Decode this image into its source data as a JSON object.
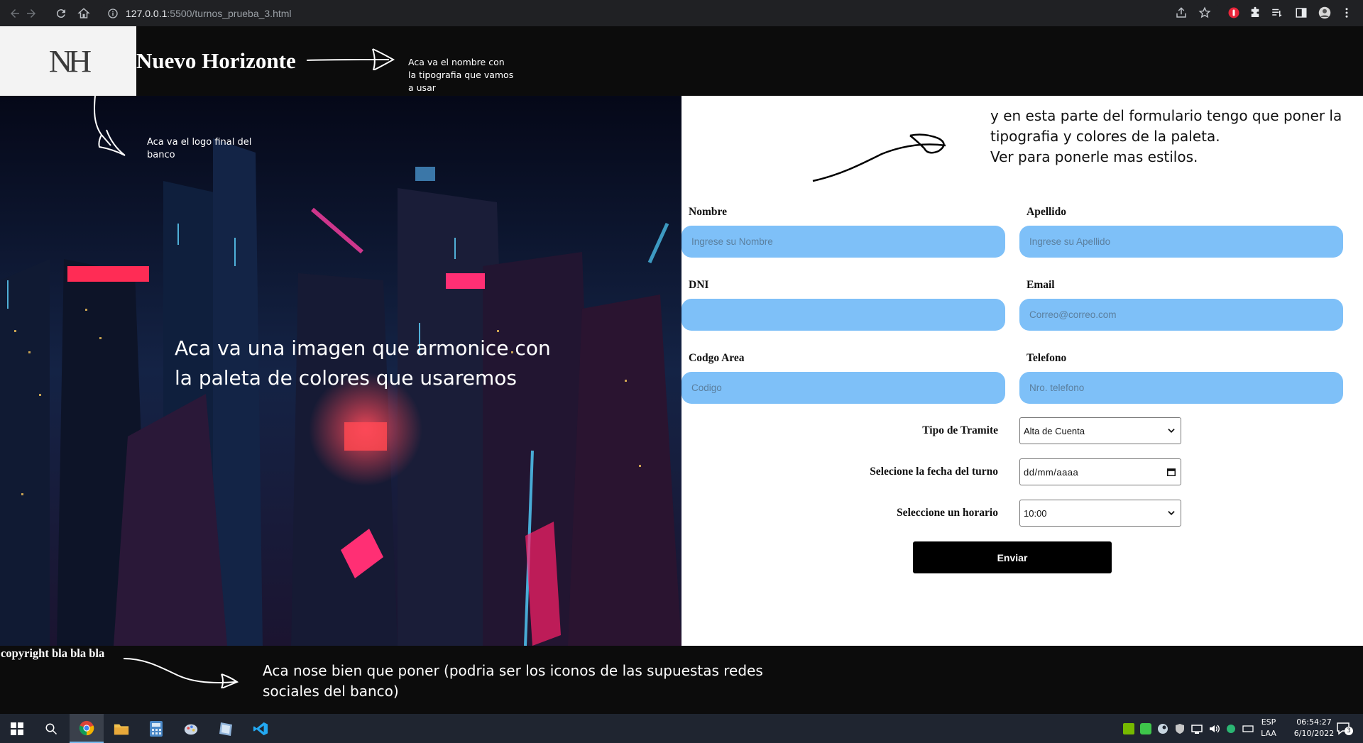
{
  "browser": {
    "url_host": "127.0.0.1",
    "url_rest": ":5500/turnos_prueba_3.html"
  },
  "header": {
    "logo_text": "NH",
    "brand_name": "Nuevo Horizonte",
    "note_name": "Aca va el nombre con la tipografia que vamos a usar"
  },
  "hero": {
    "note_logo": "Aca va el logo final del banco",
    "caption": "Aca va una imagen que armonice con la paleta de colores que usaremos"
  },
  "form": {
    "note": "y en esta parte del formulario tengo que poner la tipografia y colores de la paleta.\nVer para ponerle mas estilos.",
    "nombre": {
      "label": "Nombre",
      "placeholder": "Ingrese su Nombre"
    },
    "apellido": {
      "label": "Apellido",
      "placeholder": "Ingrese su Apellido"
    },
    "dni": {
      "label": "DNI",
      "placeholder": ""
    },
    "email": {
      "label": "Email",
      "placeholder": "Correo@correo.com"
    },
    "area": {
      "label": "Codgo Area",
      "placeholder": "Codigo"
    },
    "telefono": {
      "label": "Telefono",
      "placeholder": "Nro. telefono"
    },
    "tramite": {
      "label": "Tipo de Tramite",
      "value": "Alta de Cuenta"
    },
    "fecha": {
      "label": "Selecione la fecha del turno",
      "value": "dd/mm/aaaa"
    },
    "horario": {
      "label": "Seleccione un horario",
      "value": "10:00"
    },
    "submit_label": "Enviar"
  },
  "footer": {
    "copyright": "copyright bla bla bla",
    "note": "Aca nose bien que poner (podria ser los iconos de las supuestas redes sociales del banco)"
  },
  "taskbar": {
    "lang_top": "ESP",
    "lang_bottom": "LAA",
    "time": "06:54:27",
    "date": "6/10/2022",
    "notification_count": "3"
  },
  "colors": {
    "input_bg": "#7ec0f8",
    "header_bg": "#0c0c0c",
    "button_bg": "#000000"
  }
}
